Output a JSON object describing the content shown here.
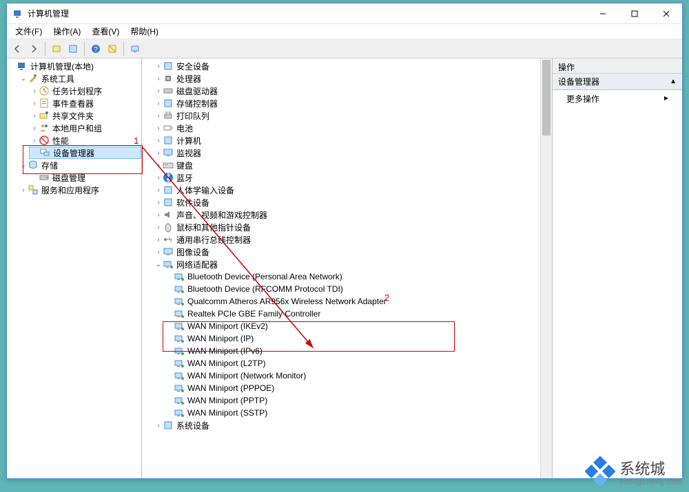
{
  "window": {
    "title": "计算机管理"
  },
  "menubar": [
    "文件(F)",
    "操作(A)",
    "查看(V)",
    "帮助(H)"
  ],
  "left_tree": {
    "root": "计算机管理(本地)",
    "system_tools": {
      "label": "系统工具",
      "children": [
        "任务计划程序",
        "事件查看器",
        "共享文件夹",
        "本地用户和组",
        "性能",
        "设备管理器"
      ]
    },
    "storage": {
      "label": "存储",
      "children": [
        "磁盘管理"
      ]
    },
    "services": {
      "label": "服务和应用程序"
    }
  },
  "devices": {
    "categories": [
      "安全设备",
      "处理器",
      "磁盘驱动器",
      "存储控制器",
      "打印队列",
      "电池",
      "计算机",
      "监视器",
      "键盘",
      "蓝牙",
      "人体学输入设备",
      "软件设备",
      "声音、视频和游戏控制器",
      "鼠标和其他指针设备",
      "通用串行总线控制器",
      "图像设备"
    ],
    "network": {
      "label": "网络适配器",
      "children": [
        "Bluetooth Device (Personal Area Network)",
        "Bluetooth Device (RFCOMM Protocol TDI)",
        "Qualcomm Atheros AR956x Wireless Network Adapter",
        "Realtek PCIe GBE Family Controller",
        "WAN Miniport (IKEv2)",
        "WAN Miniport (IP)",
        "WAN Miniport (IPv6)",
        "WAN Miniport (L2TP)",
        "WAN Miniport (Network Monitor)",
        "WAN Miniport (PPPOE)",
        "WAN Miniport (PPTP)",
        "WAN Miniport (SSTP)"
      ]
    },
    "last": "系统设备"
  },
  "right": {
    "header": "操作",
    "section": "设备管理器",
    "more": "更多操作"
  },
  "annotations": {
    "one": "1",
    "two": "2"
  },
  "watermark": {
    "text": "系统城",
    "sub": "xitongcheng.com"
  }
}
